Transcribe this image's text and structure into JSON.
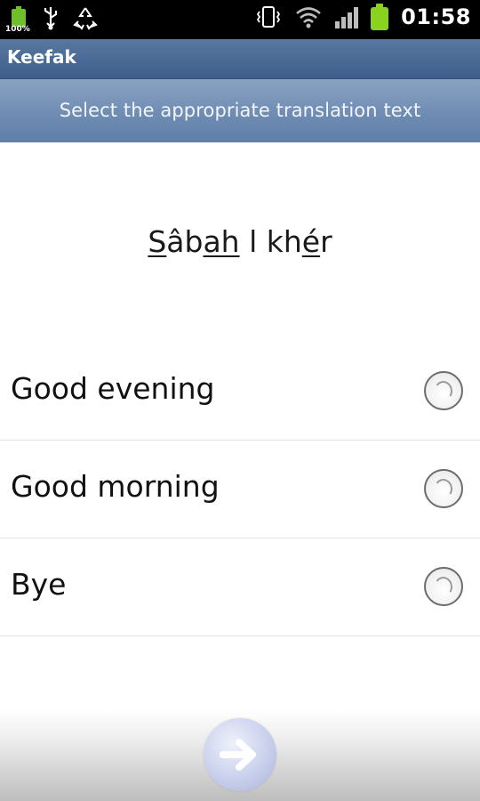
{
  "status_bar": {
    "battery_small_label": "100%",
    "time": "01:58"
  },
  "app": {
    "title": "Keefak"
  },
  "instruction": "Select the appropriate translation text",
  "phrase": {
    "parts": [
      {
        "text": "S",
        "underline": true
      },
      {
        "text": "âb",
        "underline": false
      },
      {
        "text": "ah",
        "underline": true
      },
      {
        "text": " l kh",
        "underline": false
      },
      {
        "text": "é",
        "underline": true
      },
      {
        "text": "r",
        "underline": false
      }
    ]
  },
  "options": [
    {
      "label": "Good evening",
      "selected": false
    },
    {
      "label": "Good morning",
      "selected": false
    },
    {
      "label": "Bye",
      "selected": false
    }
  ],
  "icons": {
    "next": "arrow-right-icon"
  }
}
